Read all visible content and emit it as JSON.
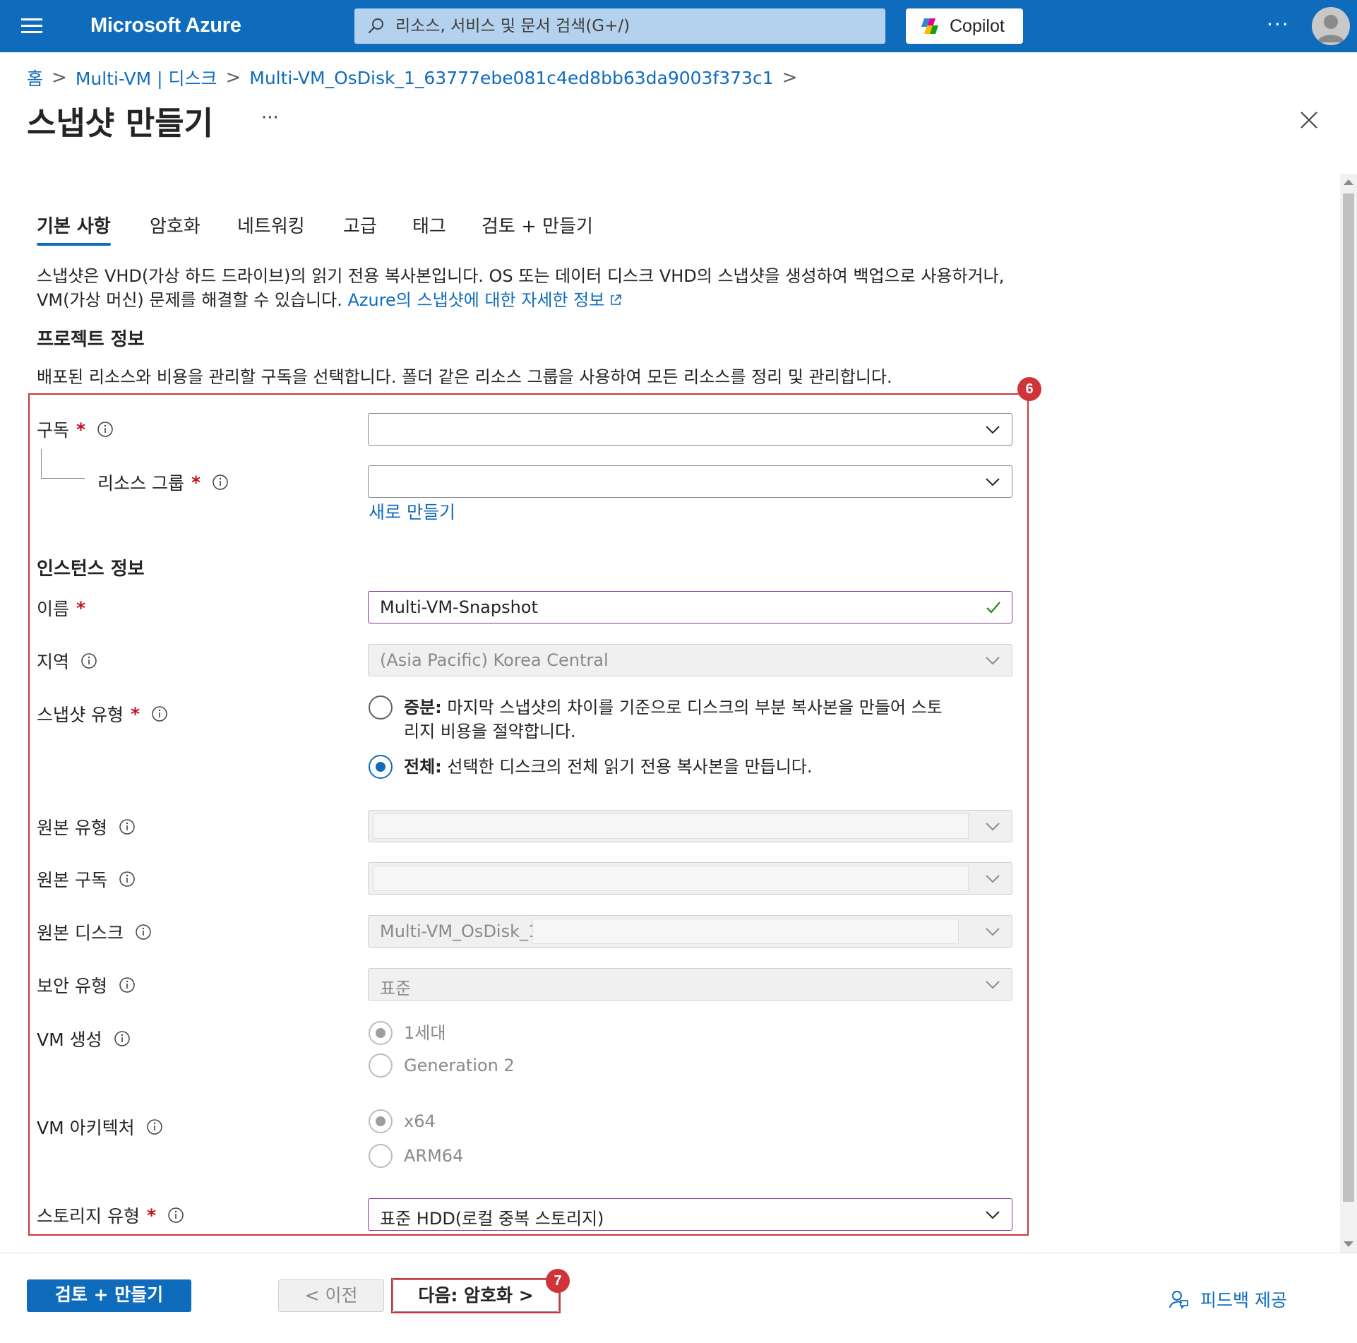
{
  "topbar": {
    "brand": "Microsoft Azure",
    "search_placeholder": "리소스, 서비스 및 문서 검색(G+/)",
    "copilot_label": "Copilot",
    "more": "···"
  },
  "breadcrumb": {
    "items": [
      "홈",
      "Multi-VM | 디스크",
      "Multi-VM_OsDisk_1_63777ebe081c4ed8bb63da9003f373c1"
    ],
    "separator": ">"
  },
  "page": {
    "title": "스냅샷 만들기",
    "more": "···"
  },
  "tabs": [
    "기본 사항",
    "암호화",
    "네트워킹",
    "고급",
    "태그",
    "검토 + 만들기"
  ],
  "intro": {
    "text": "스냅샷은 VHD(가상 하드 드라이브)의 읽기 전용 복사본입니다. OS 또는 데이터 디스크 VHD의 스냅샷을 생성하여 백업으로 사용하거나, VM(가상 머신) 문제를 해결할 수 있습니다.",
    "link": "Azure의 스냅샷에 대한 자세한 정보"
  },
  "project": {
    "heading": "프로젝트 정보",
    "description": "배포된 리소스와 비용을 관리할 구독을 선택합니다. 폴더 같은 리소스 그룹을 사용하여 모든 리소스를 정리 및 관리합니다.",
    "subscription_label": "구독",
    "resource_group_label": "리소스 그룹",
    "create_new": "새로 만들기"
  },
  "instance": {
    "heading": "인스턴스 정보",
    "name_label": "이름",
    "name_value": "Multi-VM-Snapshot",
    "region_label": "지역",
    "region_value": "(Asia Pacific) Korea Central",
    "snapshot_type_label": "스냅샷 유형",
    "incremental_title": "증분:",
    "incremental_desc_1": "마지막 스냅샷의 차이를 기준으로 디스크의 부분 복사본을 만들어 스토",
    "incremental_desc_2": "리지 비용을 절약합니다.",
    "full_title": "전체:",
    "full_desc": "선택한 디스크의 전체 읽기 전용 복사본을 만듭니다.",
    "snapshot_type_selected": "전체",
    "source_type_label": "원본 유형",
    "source_subscription_label": "원본 구독",
    "source_disk_label": "원본 디스크",
    "source_disk_value": "Multi-VM_OsDisk_1",
    "security_type_label": "보안 유형",
    "security_type_value": "표준",
    "vm_generation_label": "VM 생성",
    "gen1": "1세대",
    "gen2": "Generation 2",
    "vm_generation_selected": "1세대",
    "vm_arch_label": "VM 아키텍처",
    "arch_x64": "x64",
    "arch_arm64": "ARM64",
    "vm_arch_selected": "x64",
    "storage_type_label": "스토리지 유형",
    "storage_type_value": "표준 HDD(로컬 중복 스토리지)",
    "required_mark": "*"
  },
  "annotations": {
    "box_form": "6",
    "box_next": "7",
    "color": "#d13438"
  },
  "footer": {
    "review_create": "검토 + 만들기",
    "previous": "< 이전",
    "next": "다음: 암호화 >",
    "feedback": "피드백 제공"
  },
  "colors": {
    "accent": "#0f6cbd",
    "required": "#c50f1f",
    "valid": "#107c10"
  }
}
